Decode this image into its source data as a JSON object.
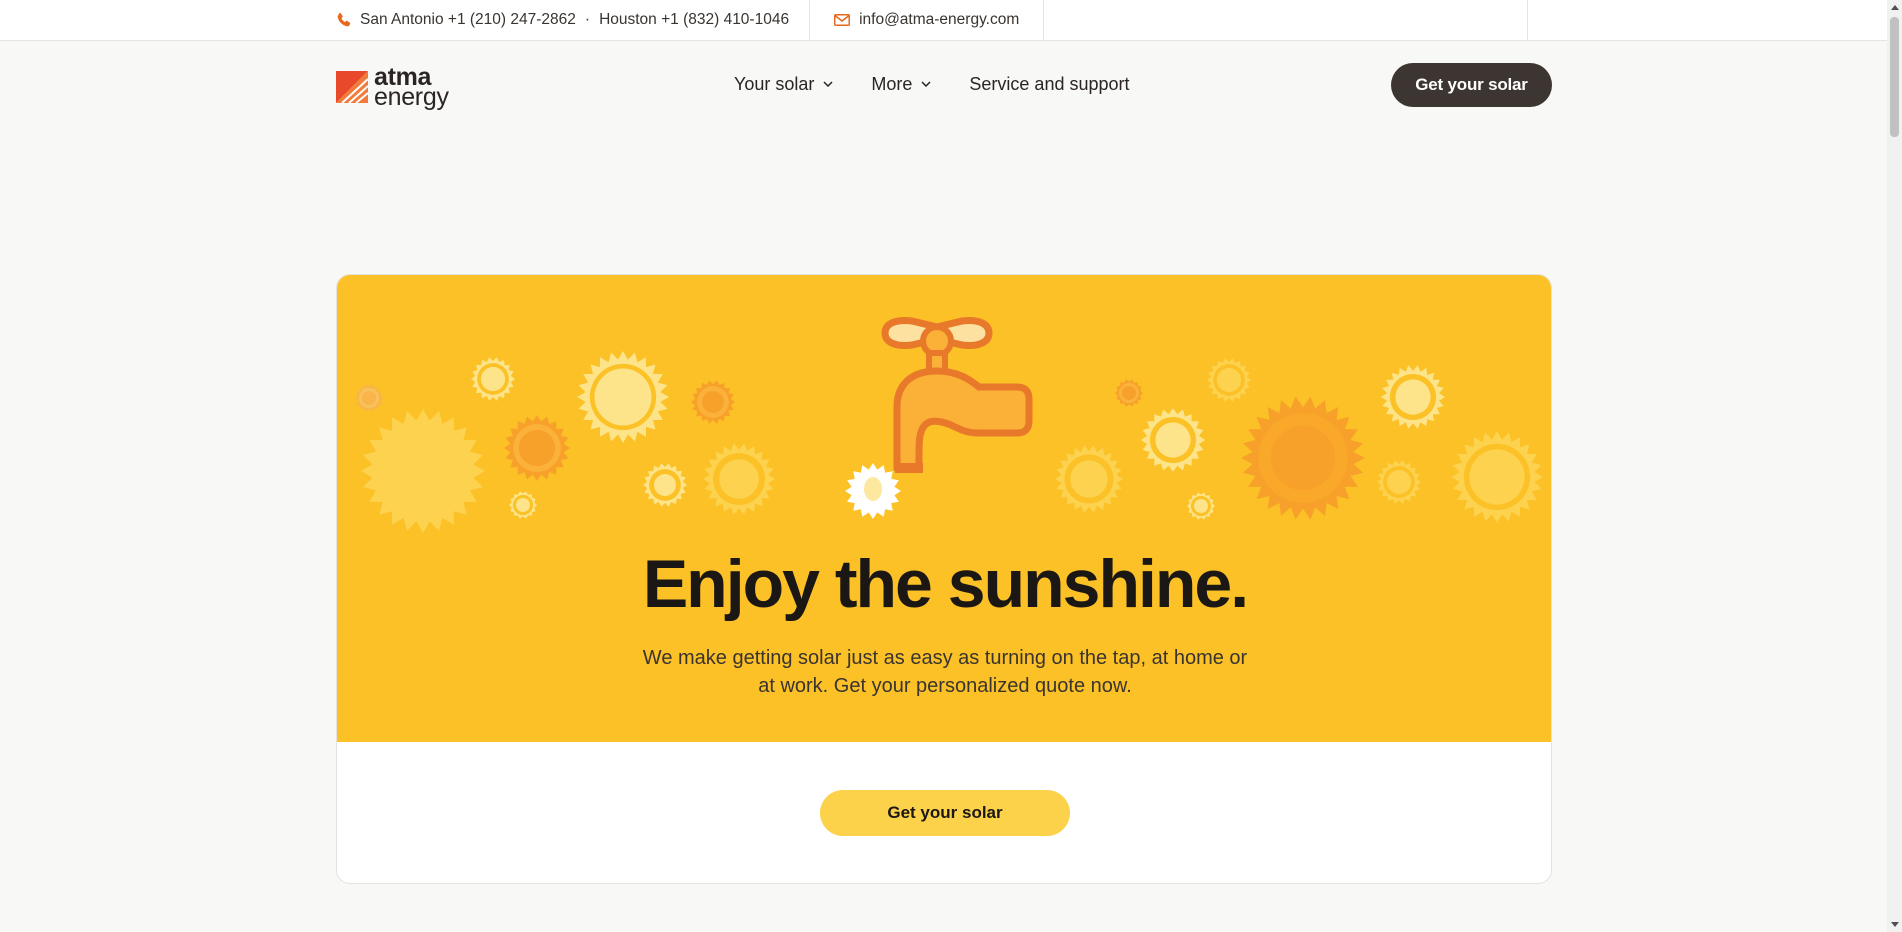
{
  "topbar": {
    "san_antonio": "San Antonio +1 (210) 247-2862",
    "separator": "·",
    "houston": "Houston +1 (832) 410-1046",
    "email": "info@atma-energy.com"
  },
  "logo": {
    "line1": "atma",
    "line2": "energy"
  },
  "nav": {
    "your_solar": "Your solar",
    "more": "More",
    "service": "Service and support"
  },
  "header": {
    "cta": "Get your solar"
  },
  "hero": {
    "title": "Enjoy the sunshine.",
    "subtitle": "We make getting solar just as easy as turning on the tap, at home or at work. Get your personalized quote now.",
    "cta": "Get your solar"
  },
  "colors": {
    "brand_orange": "#e8681d",
    "hero_yellow": "#fbc127",
    "cta_dark": "#3d3531",
    "cta_yellow": "#fcd24a"
  },
  "icons": [
    "phone-icon",
    "mail-icon",
    "chevron-down-icon",
    "faucet-illustration",
    "sun-icon"
  ]
}
